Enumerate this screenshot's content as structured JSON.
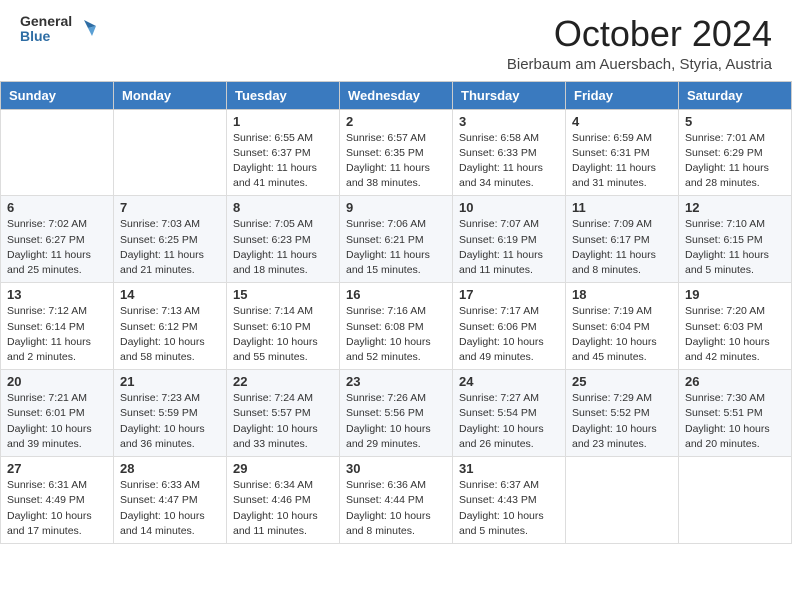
{
  "header": {
    "logo_general": "General",
    "logo_blue": "Blue",
    "month_title": "October 2024",
    "location": "Bierbaum am Auersbach, Styria, Austria"
  },
  "days_of_week": [
    "Sunday",
    "Monday",
    "Tuesday",
    "Wednesday",
    "Thursday",
    "Friday",
    "Saturday"
  ],
  "weeks": [
    [
      {
        "day": "",
        "info": ""
      },
      {
        "day": "",
        "info": ""
      },
      {
        "day": "1",
        "info": "Sunrise: 6:55 AM\nSunset: 6:37 PM\nDaylight: 11 hours and 41 minutes."
      },
      {
        "day": "2",
        "info": "Sunrise: 6:57 AM\nSunset: 6:35 PM\nDaylight: 11 hours and 38 minutes."
      },
      {
        "day": "3",
        "info": "Sunrise: 6:58 AM\nSunset: 6:33 PM\nDaylight: 11 hours and 34 minutes."
      },
      {
        "day": "4",
        "info": "Sunrise: 6:59 AM\nSunset: 6:31 PM\nDaylight: 11 hours and 31 minutes."
      },
      {
        "day": "5",
        "info": "Sunrise: 7:01 AM\nSunset: 6:29 PM\nDaylight: 11 hours and 28 minutes."
      }
    ],
    [
      {
        "day": "6",
        "info": "Sunrise: 7:02 AM\nSunset: 6:27 PM\nDaylight: 11 hours and 25 minutes."
      },
      {
        "day": "7",
        "info": "Sunrise: 7:03 AM\nSunset: 6:25 PM\nDaylight: 11 hours and 21 minutes."
      },
      {
        "day": "8",
        "info": "Sunrise: 7:05 AM\nSunset: 6:23 PM\nDaylight: 11 hours and 18 minutes."
      },
      {
        "day": "9",
        "info": "Sunrise: 7:06 AM\nSunset: 6:21 PM\nDaylight: 11 hours and 15 minutes."
      },
      {
        "day": "10",
        "info": "Sunrise: 7:07 AM\nSunset: 6:19 PM\nDaylight: 11 hours and 11 minutes."
      },
      {
        "day": "11",
        "info": "Sunrise: 7:09 AM\nSunset: 6:17 PM\nDaylight: 11 hours and 8 minutes."
      },
      {
        "day": "12",
        "info": "Sunrise: 7:10 AM\nSunset: 6:15 PM\nDaylight: 11 hours and 5 minutes."
      }
    ],
    [
      {
        "day": "13",
        "info": "Sunrise: 7:12 AM\nSunset: 6:14 PM\nDaylight: 11 hours and 2 minutes."
      },
      {
        "day": "14",
        "info": "Sunrise: 7:13 AM\nSunset: 6:12 PM\nDaylight: 10 hours and 58 minutes."
      },
      {
        "day": "15",
        "info": "Sunrise: 7:14 AM\nSunset: 6:10 PM\nDaylight: 10 hours and 55 minutes."
      },
      {
        "day": "16",
        "info": "Sunrise: 7:16 AM\nSunset: 6:08 PM\nDaylight: 10 hours and 52 minutes."
      },
      {
        "day": "17",
        "info": "Sunrise: 7:17 AM\nSunset: 6:06 PM\nDaylight: 10 hours and 49 minutes."
      },
      {
        "day": "18",
        "info": "Sunrise: 7:19 AM\nSunset: 6:04 PM\nDaylight: 10 hours and 45 minutes."
      },
      {
        "day": "19",
        "info": "Sunrise: 7:20 AM\nSunset: 6:03 PM\nDaylight: 10 hours and 42 minutes."
      }
    ],
    [
      {
        "day": "20",
        "info": "Sunrise: 7:21 AM\nSunset: 6:01 PM\nDaylight: 10 hours and 39 minutes."
      },
      {
        "day": "21",
        "info": "Sunrise: 7:23 AM\nSunset: 5:59 PM\nDaylight: 10 hours and 36 minutes."
      },
      {
        "day": "22",
        "info": "Sunrise: 7:24 AM\nSunset: 5:57 PM\nDaylight: 10 hours and 33 minutes."
      },
      {
        "day": "23",
        "info": "Sunrise: 7:26 AM\nSunset: 5:56 PM\nDaylight: 10 hours and 29 minutes."
      },
      {
        "day": "24",
        "info": "Sunrise: 7:27 AM\nSunset: 5:54 PM\nDaylight: 10 hours and 26 minutes."
      },
      {
        "day": "25",
        "info": "Sunrise: 7:29 AM\nSunset: 5:52 PM\nDaylight: 10 hours and 23 minutes."
      },
      {
        "day": "26",
        "info": "Sunrise: 7:30 AM\nSunset: 5:51 PM\nDaylight: 10 hours and 20 minutes."
      }
    ],
    [
      {
        "day": "27",
        "info": "Sunrise: 6:31 AM\nSunset: 4:49 PM\nDaylight: 10 hours and 17 minutes."
      },
      {
        "day": "28",
        "info": "Sunrise: 6:33 AM\nSunset: 4:47 PM\nDaylight: 10 hours and 14 minutes."
      },
      {
        "day": "29",
        "info": "Sunrise: 6:34 AM\nSunset: 4:46 PM\nDaylight: 10 hours and 11 minutes."
      },
      {
        "day": "30",
        "info": "Sunrise: 6:36 AM\nSunset: 4:44 PM\nDaylight: 10 hours and 8 minutes."
      },
      {
        "day": "31",
        "info": "Sunrise: 6:37 AM\nSunset: 4:43 PM\nDaylight: 10 hours and 5 minutes."
      },
      {
        "day": "",
        "info": ""
      },
      {
        "day": "",
        "info": ""
      }
    ]
  ]
}
